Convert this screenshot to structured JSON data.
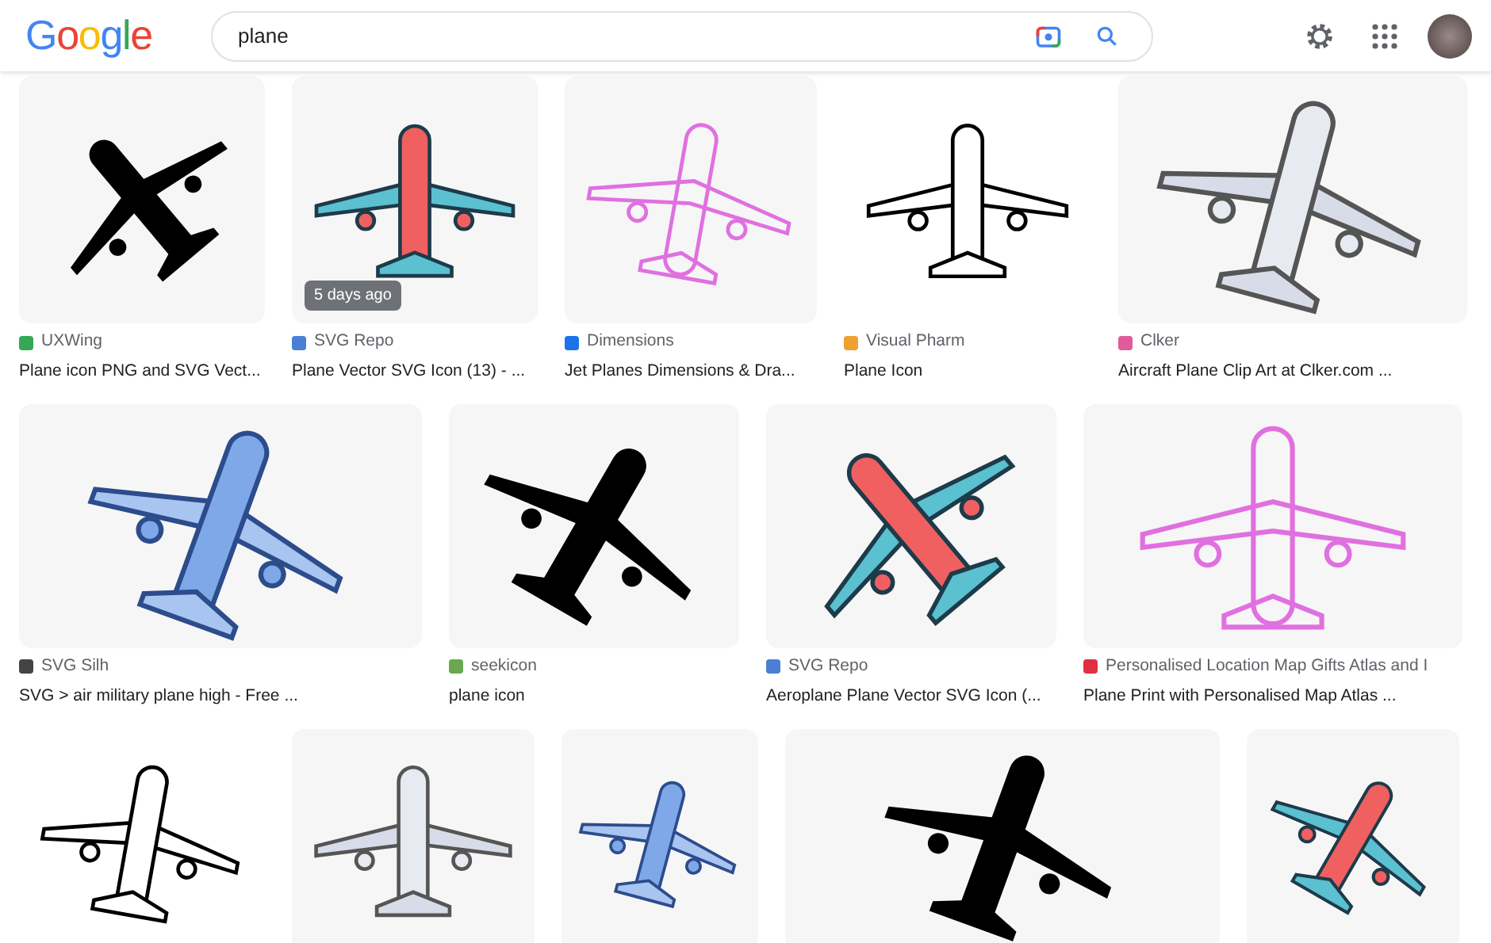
{
  "logo": "Google",
  "search": {
    "value": "plane"
  },
  "rows": [
    {
      "items": [
        {
          "kind": "picture",
          "source": "UXWing",
          "color": "#34a853",
          "title": "Plane icon PNG and SVG Vect..."
        },
        {
          "kind": "picture",
          "source": "SVG Repo",
          "color": "#4a7fd6",
          "title": "Plane Vector SVG Icon (13) - ...",
          "badge": "5 days ago"
        },
        {
          "kind": "picture",
          "source": "Dimensions",
          "color": "#1a73e8",
          "title": "Jet Planes Dimensions & Dra..."
        },
        {
          "kind": "picture",
          "source": "Visual Pharm",
          "color": "#f0a030",
          "title": "Plane Icon"
        },
        {
          "kind": "picture",
          "source": "Clker",
          "color": "#e05a9c",
          "title": "Aircraft Plane Clip Art at Clker.com ..."
        }
      ]
    },
    {
      "items": [
        {
          "kind": "picture",
          "source": "SVG Silh",
          "color": "#444444",
          "title": "SVG > air military plane high - Free ..."
        },
        {
          "kind": "picture",
          "source": "seekicon",
          "color": "#6aa84f",
          "title": "plane icon"
        },
        {
          "kind": "picture",
          "source": "SVG Repo",
          "color": "#4a7fd6",
          "title": "Aeroplane Plane Vector SVG Icon (..."
        },
        {
          "kind": "picture",
          "source": "Personalised Location Map Gifts Atlas and I",
          "color": "#e03040",
          "title": "Plane Print with Personalised Map Atlas ..."
        }
      ]
    },
    {
      "items": [
        {
          "kind": "picture"
        },
        {
          "kind": "picture"
        },
        {
          "kind": "picture"
        },
        {
          "kind": "picture"
        },
        {
          "kind": "picture"
        }
      ]
    }
  ]
}
